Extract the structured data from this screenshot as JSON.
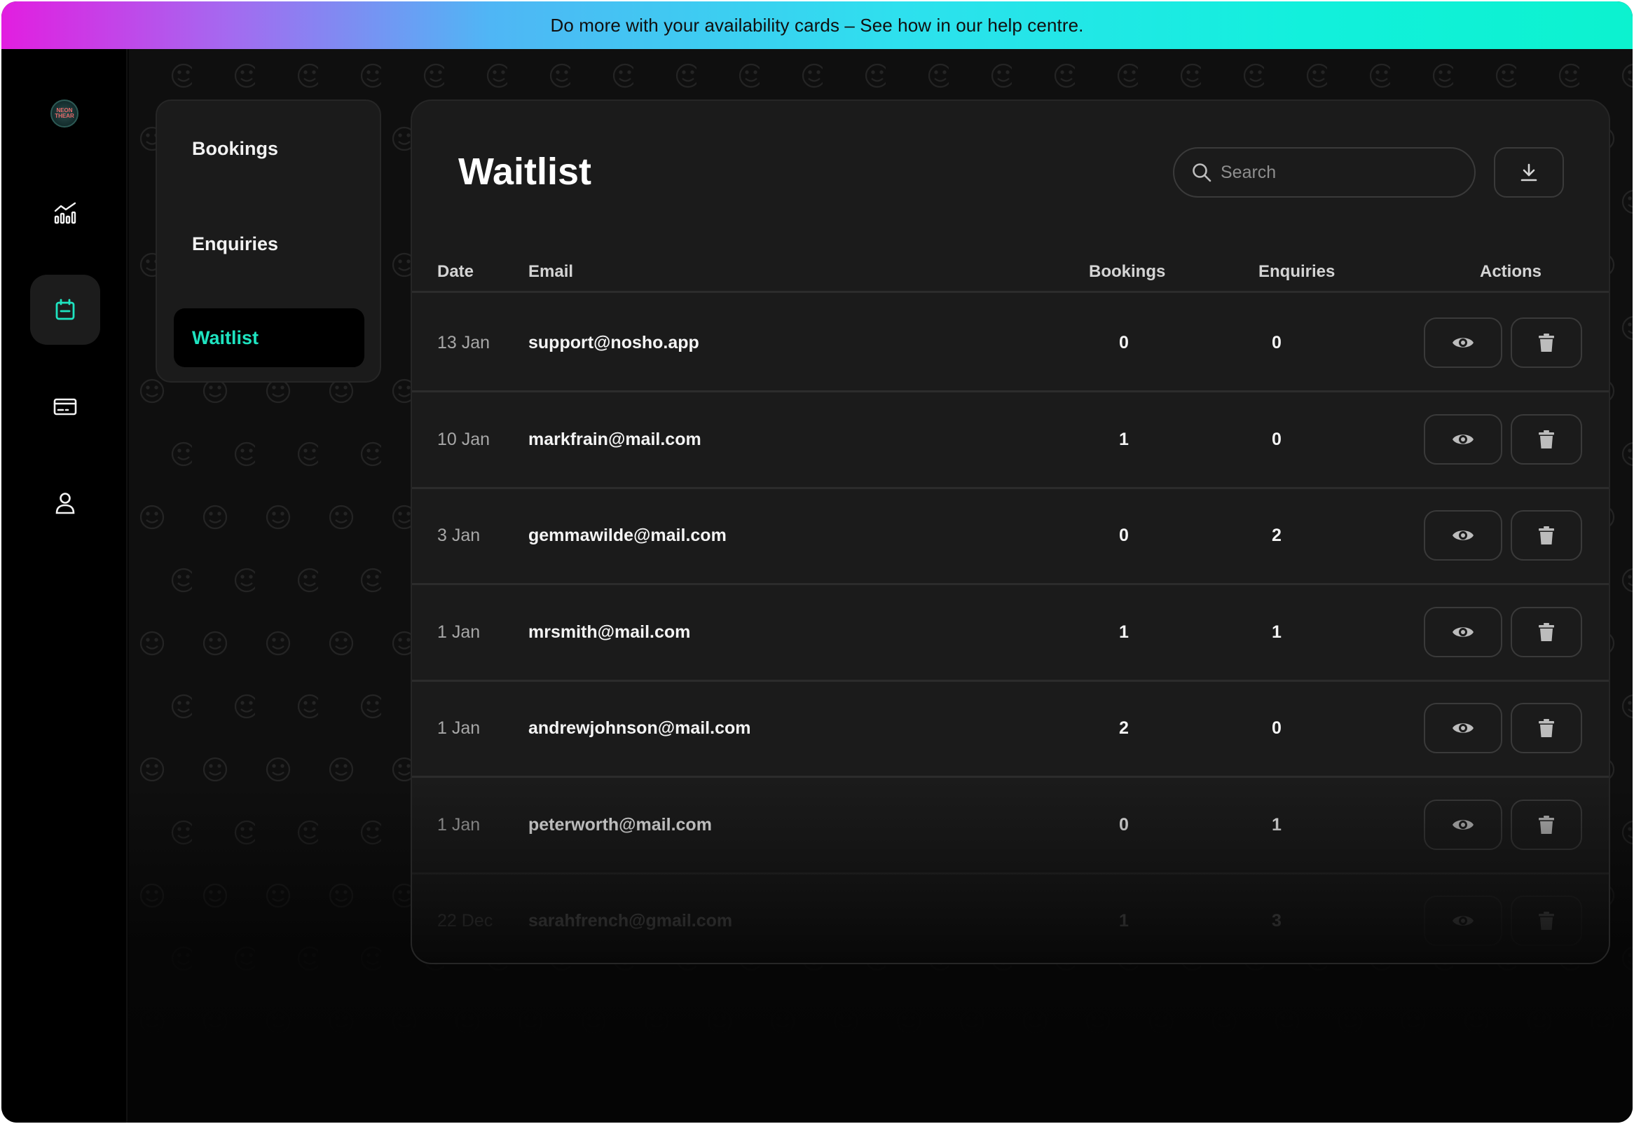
{
  "banner": {
    "text": "Do more with your availability cards – See how in our help centre."
  },
  "brand": {
    "logo_text": "NEON\nTHEAR"
  },
  "rail": {
    "items": [
      {
        "name": "analytics",
        "icon": "analytics-chart-icon",
        "active": false
      },
      {
        "name": "calendar",
        "icon": "calendar-icon",
        "active": true
      },
      {
        "name": "payments",
        "icon": "credit-card-icon",
        "active": false
      },
      {
        "name": "account",
        "icon": "user-icon",
        "active": false
      }
    ]
  },
  "subnav": {
    "items": [
      {
        "label": "Bookings",
        "active": false
      },
      {
        "label": "Enquiries",
        "active": false
      },
      {
        "label": "Waitlist",
        "active": true
      }
    ]
  },
  "main": {
    "title": "Waitlist",
    "search": {
      "placeholder": "Search",
      "value": ""
    },
    "download": {
      "icon": "download-icon"
    },
    "columns": [
      "Date",
      "Email",
      "Bookings",
      "Enquiries",
      "Actions"
    ],
    "rows": [
      {
        "date": "13 Jan",
        "email": "support@nosho.app",
        "bookings": "0",
        "enquiries": "0"
      },
      {
        "date": "10 Jan",
        "email": "markfrain@mail.com",
        "bookings": "1",
        "enquiries": "0"
      },
      {
        "date": "3 Jan",
        "email": "gemmawilde@mail.com",
        "bookings": "0",
        "enquiries": "2"
      },
      {
        "date": "1 Jan",
        "email": "mrsmith@mail.com",
        "bookings": "1",
        "enquiries": "1"
      },
      {
        "date": "1 Jan",
        "email": "andrewjohnson@mail.com",
        "bookings": "2",
        "enquiries": "0"
      },
      {
        "date": "1 Jan",
        "email": "peterworth@mail.com",
        "bookings": "0",
        "enquiries": "1"
      },
      {
        "date": "22 Dec",
        "email": "sarahfrench@gmail.com",
        "bookings": "1",
        "enquiries": "3"
      }
    ]
  },
  "colors": {
    "accent": "#1ee3c0",
    "background": "#050505",
    "card": "#1b1b1b"
  }
}
